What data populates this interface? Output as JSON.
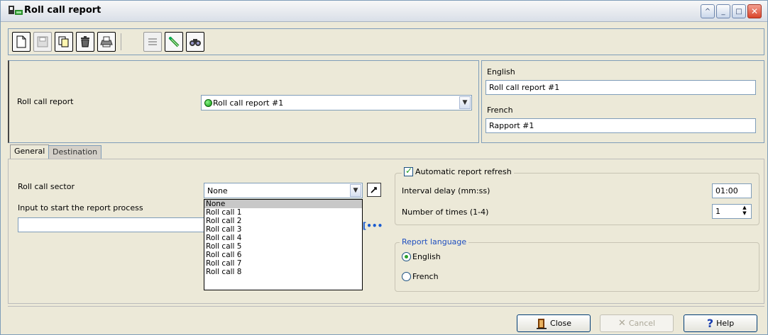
{
  "window": {
    "title": "Roll call report",
    "controls": [
      "help-icon",
      "minimize-icon",
      "maximize-icon",
      "close-icon"
    ]
  },
  "toolbar": {
    "buttons": [
      "new-icon",
      "save-icon",
      "copy-icon",
      "delete-icon",
      "print-icon",
      "list-icon",
      "link-icon",
      "find-icon"
    ]
  },
  "header": {
    "report_label": "Roll call report",
    "report_value": "Roll call report #1",
    "status_color": "#11b311"
  },
  "languages": {
    "english_label": "English",
    "english_value": "Roll call report #1",
    "french_label": "French",
    "french_value": "Rapport #1"
  },
  "tabs": [
    {
      "label": "General",
      "active": true
    },
    {
      "label": "Destination",
      "active": false
    }
  ],
  "general": {
    "sector_label": "Roll call sector",
    "sector_value": "None",
    "input_label": "Input to start the report process",
    "input_value": "",
    "dropdown_options": [
      "None",
      "Roll call 1",
      "Roll call 2",
      "Roll call 3",
      "Roll call 4",
      "Roll call 5",
      "Roll call 6",
      "Roll call 7",
      "Roll call 8"
    ],
    "dropdown_selected": "None"
  },
  "refresh": {
    "title": "Automatic report refresh",
    "checked": true,
    "interval_label": "Interval delay (mm:ss)",
    "interval_value": "01:00",
    "times_label": "Number of times (1-4)",
    "times_value": "1"
  },
  "report_language": {
    "title": "Report language",
    "options": [
      "English",
      "French"
    ],
    "selected": "English"
  },
  "footer": {
    "close_label": "Close",
    "cancel_label": "Cancel",
    "help_label": "Help"
  }
}
